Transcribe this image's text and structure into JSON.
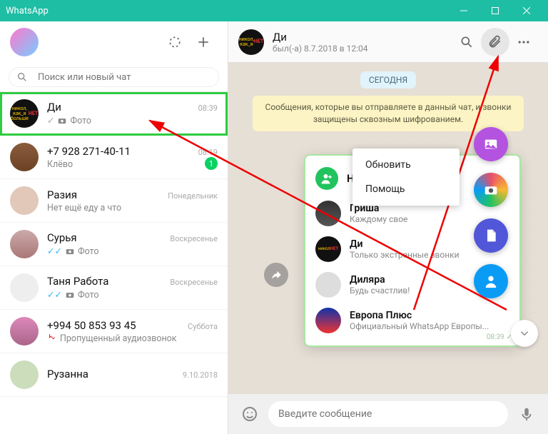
{
  "titlebar": {
    "title": "WhatsApp"
  },
  "search": {
    "placeholder": "Поиск или новый чат"
  },
  "chats": [
    {
      "name": "Ди",
      "preview": "Фото",
      "time": "08:39",
      "hasPhoto": true,
      "selected": true,
      "tick": "single"
    },
    {
      "name": "+7 928 271-40-11",
      "preview": "Клёво",
      "time": "08:19",
      "badge": "1"
    },
    {
      "name": "Разия",
      "preview": "Нет ещё еду а что",
      "time": "Понедельник"
    },
    {
      "name": "Сурья",
      "preview": "Фото",
      "time": "Воскресенье",
      "hasPhoto": true,
      "tick": "double"
    },
    {
      "name": "Таня Работа",
      "preview": "Фото",
      "time": "Воскресенье",
      "hasPhoto": true,
      "tick": "double"
    },
    {
      "name": "+994 50 853 93 45",
      "preview": "Пропущенный аудиозвонок",
      "time": "Суббота",
      "missed": true
    },
    {
      "name": "Рузанна",
      "preview": "",
      "time": "9.10.2018"
    }
  ],
  "conversation": {
    "name": "Ди",
    "last_seen": "был(-а) 8.7.2018 в 12:04",
    "day": "СЕГОДНЯ",
    "encryption": "Сообщения, которые вы отправляете в данный чат, и звонки защищены сквозным шифрованием."
  },
  "menu": {
    "items": [
      "Обновить",
      "Помощь"
    ]
  },
  "contact_popup": {
    "header": "Новый кон",
    "time_badge": "08:39",
    "contacts": [
      {
        "name": "Гриша",
        "status": "Каждому свое"
      },
      {
        "name": "Ди",
        "status": "Только экстренные звонки"
      },
      {
        "name": "Диляра",
        "status": "Будь счастлив!"
      },
      {
        "name": "Европа Плюс",
        "status": "Официальный WhatsApp Европы..."
      }
    ]
  },
  "compose": {
    "placeholder": "Введите сообщение"
  },
  "fabs": [
    {
      "name": "gallery",
      "color": "#b453e0"
    },
    {
      "name": "camera",
      "color": "#e84f6a"
    },
    {
      "name": "document",
      "color": "#5157d8"
    },
    {
      "name": "contact",
      "color": "#0a9cf5"
    }
  ]
}
